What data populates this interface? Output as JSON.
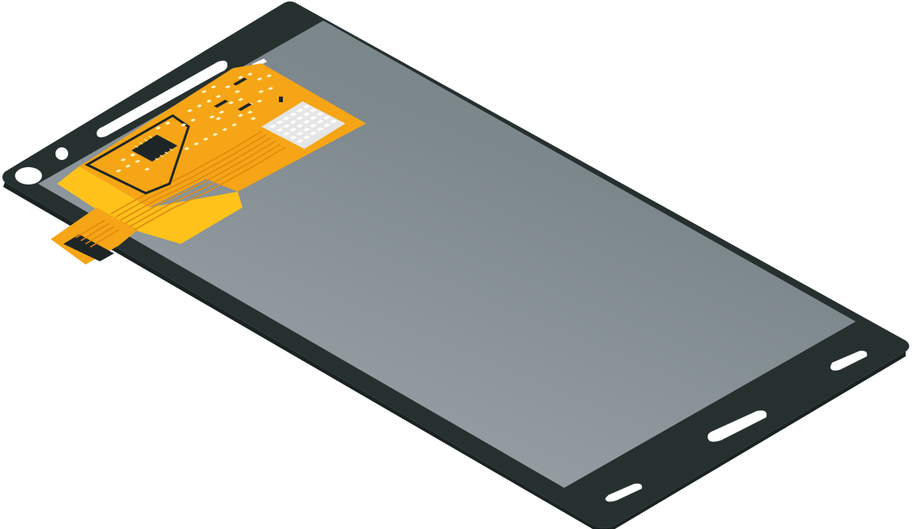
{
  "illustration": {
    "subject": "lcd-display-module",
    "colors": {
      "background": "#ffffff",
      "frame": "#26302f",
      "frame_edge": "#1a2322",
      "screen": "#7c878c",
      "screen_light": "#a3abb0",
      "pcb": "#f5a515",
      "pcb_light": "#ffc21a",
      "pcb_trace": "#e08a10",
      "flex_cable": "#f5a515",
      "chip": "#1d2526",
      "pad": "#fff3c9",
      "shield": "#e6e6e6",
      "hole": "#ffffff"
    }
  }
}
